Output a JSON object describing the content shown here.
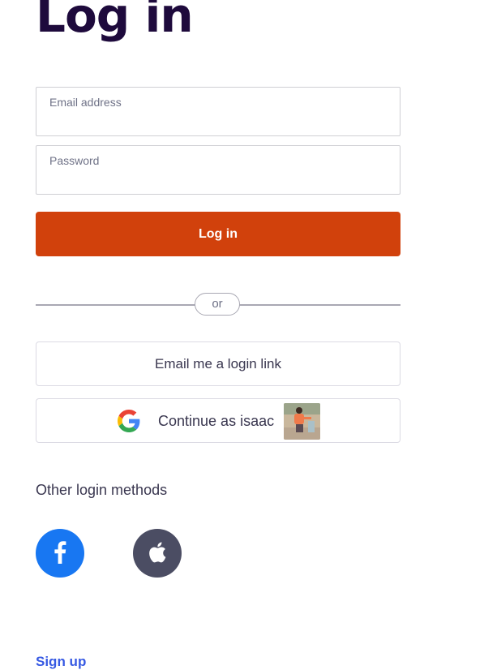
{
  "page": {
    "title": "Log in"
  },
  "form": {
    "email": {
      "label": "Email address",
      "value": ""
    },
    "password": {
      "label": "Password",
      "value": ""
    },
    "submit_label": "Log in"
  },
  "divider": {
    "label": "or"
  },
  "alternatives": {
    "email_link_label": "Email me a login link",
    "continue_label": "Continue as isaac",
    "continue_icon": "google-icon"
  },
  "other_methods": {
    "heading": "Other login methods",
    "providers": [
      {
        "name": "facebook",
        "icon": "facebook-icon",
        "color": "#1877f2"
      },
      {
        "name": "apple",
        "icon": "apple-icon",
        "color": "#4b4d63"
      }
    ]
  },
  "footer": {
    "signup_label": "Sign up"
  },
  "colors": {
    "brand": "#d1410c",
    "title": "#1e0a3c",
    "link": "#3659e3"
  }
}
